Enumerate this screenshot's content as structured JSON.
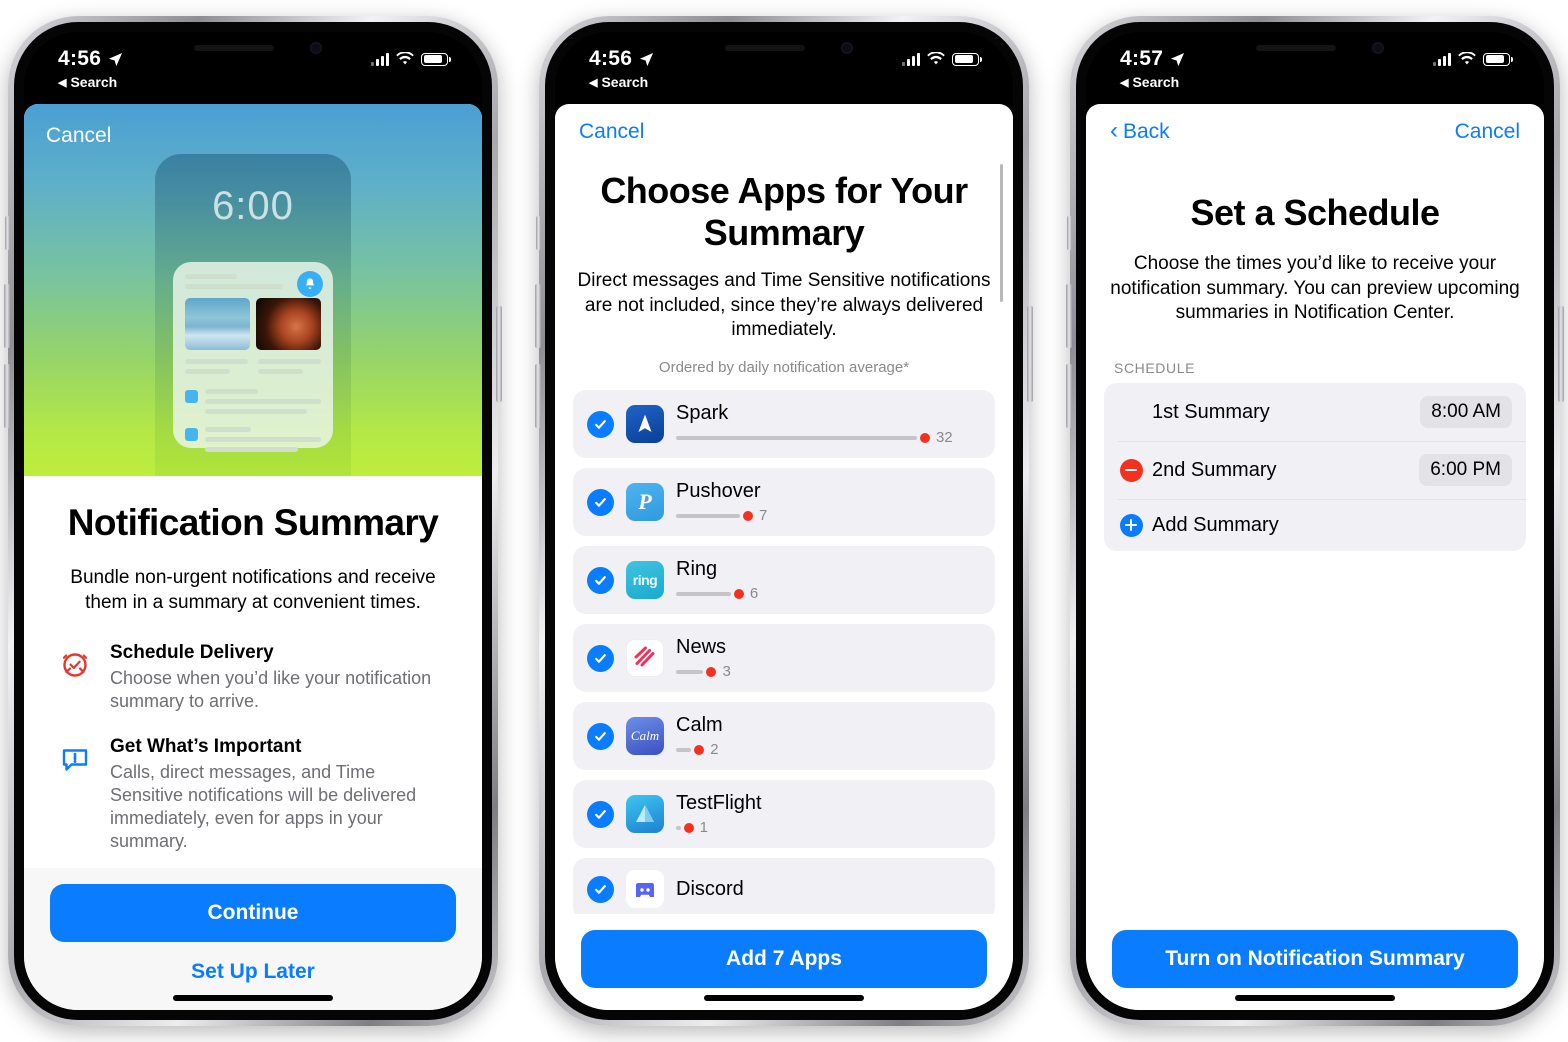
{
  "phones": [
    {
      "status": {
        "time": "4:56",
        "back_label": "Search",
        "location_icon": "location-arrow-icon",
        "signal_icon": "cellular-bars-icon",
        "wifi_icon": "wifi-icon",
        "battery_icon": "battery-icon"
      },
      "nav": {
        "cancel": "Cancel"
      },
      "hero": {
        "mock_time": "6:00",
        "bell_icon": "bell-icon"
      },
      "title": "Notification Summary",
      "subtitle": "Bundle non-urgent notifications and receive them in a summary at convenient times.",
      "features": [
        {
          "icon": "alarm-clock-icon",
          "icon_color": "#e8342a",
          "heading": "Schedule Delivery",
          "text": "Choose when you’d like your notification summary to arrive."
        },
        {
          "icon": "exclamation-bubble-icon",
          "icon_color": "#0a7cff",
          "heading": "Get What’s Important",
          "text": "Calls, direct messages, and Time Sensitive notifications will be delivered immediately, even for apps in your summary."
        }
      ],
      "primary_button": "Continue",
      "secondary_button": "Set Up Later"
    },
    {
      "status": {
        "time": "4:56",
        "back_label": "Search"
      },
      "nav": {
        "cancel": "Cancel"
      },
      "title": "Choose Apps for Your Summary",
      "subtitle": "Direct messages and Time Sensitive notifications are not included, since they’re always delivered immediately.",
      "note": "Ordered by daily notification average*",
      "apps": [
        {
          "name": "Spark",
          "count": "32",
          "meter_pct": 100,
          "checked": true,
          "icon": "spark-app-icon"
        },
        {
          "name": "Pushover",
          "count": "7",
          "meter_pct": 25,
          "checked": true,
          "icon": "pushover-app-icon"
        },
        {
          "name": "Ring",
          "count": "6",
          "meter_pct": 21,
          "checked": true,
          "icon": "ring-app-icon"
        },
        {
          "name": "News",
          "count": "3",
          "meter_pct": 11,
          "checked": true,
          "icon": "news-app-icon"
        },
        {
          "name": "Calm",
          "count": "2",
          "meter_pct": 6,
          "checked": true,
          "icon": "calm-app-icon"
        },
        {
          "name": "TestFlight",
          "count": "1",
          "meter_pct": 2,
          "checked": true,
          "icon": "testflight-app-icon"
        },
        {
          "name": "Discord",
          "count": "",
          "meter_pct": 0,
          "checked": true,
          "icon": "discord-app-icon"
        }
      ],
      "primary_button": "Add 7 Apps"
    },
    {
      "status": {
        "time": "4:57",
        "back_label": "Search"
      },
      "nav": {
        "back": "Back",
        "cancel": "Cancel"
      },
      "title": "Set a Schedule",
      "subtitle": "Choose the times you’d like to receive your notification summary. You can preview upcoming summaries in Notification Center.",
      "section_label": "SCHEDULE",
      "rows": [
        {
          "lead": "none",
          "title": "1st Summary",
          "time": "8:00 AM"
        },
        {
          "lead": "minus",
          "title": "2nd Summary",
          "time": "6:00 PM"
        },
        {
          "lead": "plus",
          "title": "Add Summary",
          "time": ""
        }
      ],
      "primary_button": "Turn on Notification Summary"
    }
  ],
  "colors": {
    "accent": "#0a7cff",
    "red": "#f4301f",
    "row_bg": "#f1f1f5",
    "muted": "#8a8a8e"
  }
}
